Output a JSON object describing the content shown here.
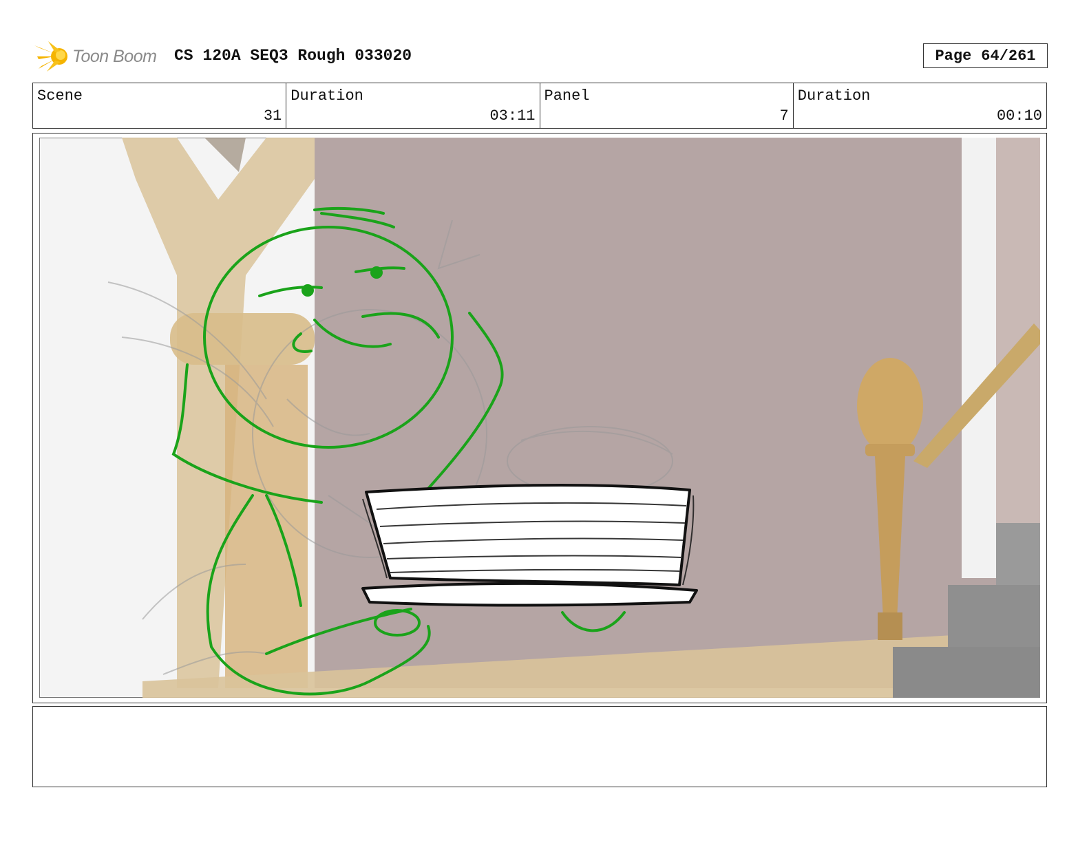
{
  "header": {
    "brand": "Toon Boom",
    "title": "CS 120A SEQ3 Rough 033020",
    "page_label": "Page",
    "page_value": "64/261"
  },
  "info": {
    "scene_label": "Scene",
    "scene_value": "31",
    "scene_duration_label": "Duration",
    "scene_duration_value": "03:11",
    "panel_label": "Panel",
    "panel_value": "7",
    "panel_duration_label": "Duration",
    "panel_duration_value": "00:10"
  },
  "colors": {
    "logo_star": "#f5b400",
    "sketch_green": "#1aa31a",
    "wall": "#b5a5a4",
    "wood": "#c9a96a"
  },
  "panel": {
    "image": "storyboard sketch of character holding stack of plates"
  },
  "notes": {
    "text": ""
  }
}
